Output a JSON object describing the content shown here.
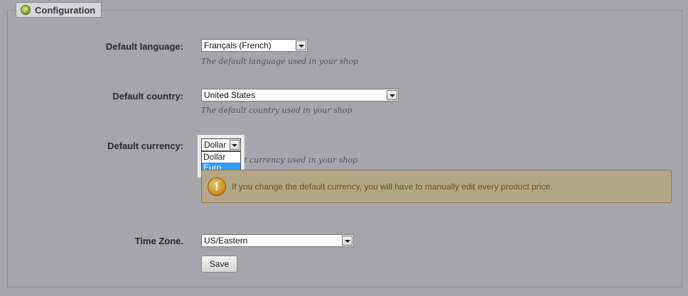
{
  "section": {
    "title": "Configuration",
    "icon": "gear-pencil-icon"
  },
  "language": {
    "label": "Default language:",
    "value": "Français (French)",
    "hint": "The default language used in your shop"
  },
  "country": {
    "label": "Default country:",
    "value": "United States",
    "hint": "The default country used in your shop"
  },
  "currency": {
    "label": "Default currency:",
    "value": "Dollar",
    "hint_visible": "t currency used in your shop",
    "options": [
      "Dollar",
      "Euro"
    ],
    "highlighted_option": "Euro"
  },
  "warning": {
    "icon": "warning-exclamation-icon",
    "text": "If you change the default currency, you will have to manually edit every product price."
  },
  "timezone": {
    "label": "Time Zone.",
    "value": "US/Eastern"
  },
  "actions": {
    "save_label": "Save"
  }
}
